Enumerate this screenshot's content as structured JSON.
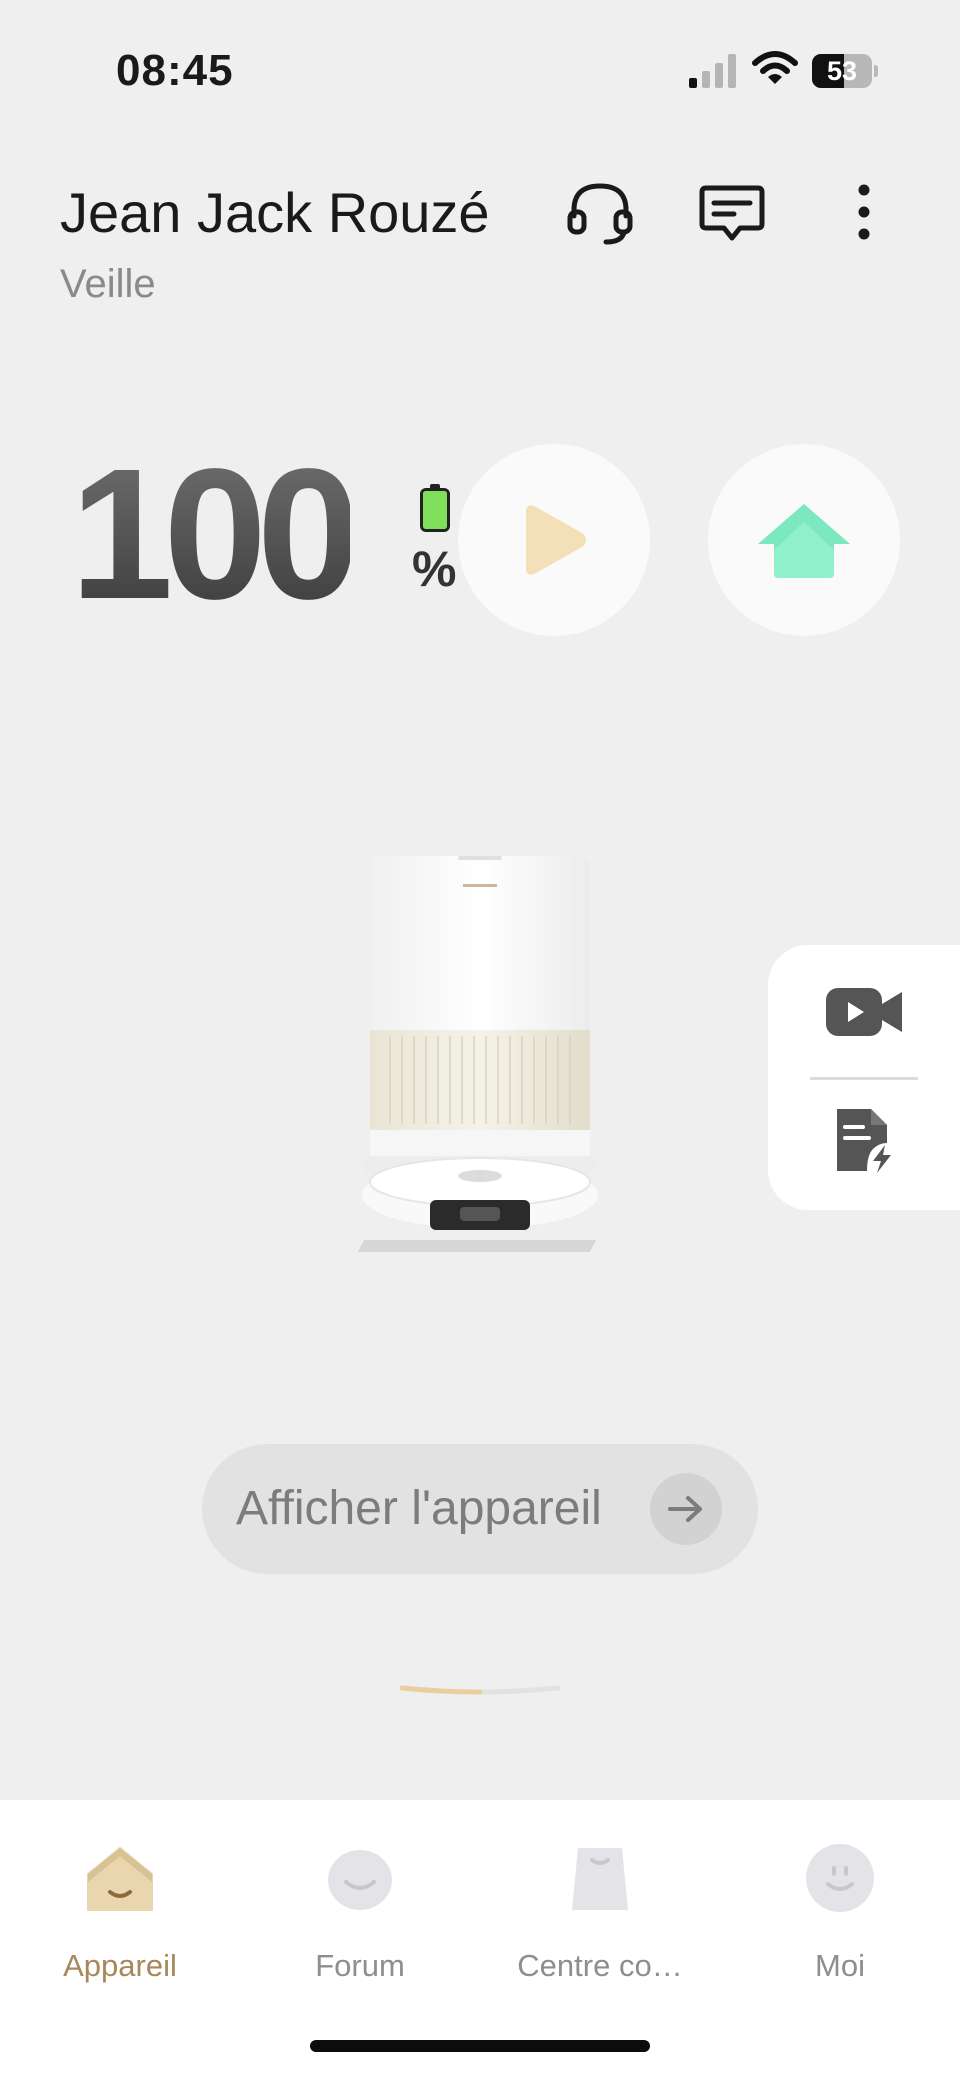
{
  "status_bar": {
    "time": "08:45",
    "battery_level": "53",
    "battery_fraction": 0.53,
    "signal_bars_active": 1
  },
  "header": {
    "device_name": "Jean Jack Rouzé",
    "status": "Veille",
    "icons": [
      "headset-support-icon",
      "message-icon",
      "more-vertical-icon"
    ]
  },
  "battery": {
    "value": "100",
    "unit": "%",
    "level": 1.0,
    "color": "#7ee05b"
  },
  "actions": {
    "start_icon": "play-icon",
    "start_color": "#f3dfb8",
    "dock_icon": "home-dock-icon",
    "dock_color": "#8ff0cc"
  },
  "side_panel": {
    "items": [
      "video-camera-icon",
      "quick-document-icon"
    ]
  },
  "show_device": {
    "label": "Afficher l'appareil",
    "icon": "arrow-right-icon"
  },
  "pager": {
    "active_fraction": 0.5,
    "active_color": "#eacf9e"
  },
  "tabbar": {
    "tabs": [
      {
        "label": "Appareil",
        "icon": "device-home-icon",
        "active": true
      },
      {
        "label": "Forum",
        "icon": "forum-icon",
        "active": false
      },
      {
        "label": "Centre co…",
        "icon": "shopping-bag-icon",
        "active": false
      },
      {
        "label": "Moi",
        "icon": "profile-face-icon",
        "active": false
      }
    ],
    "active_color": "#a8875a"
  },
  "colors": {
    "background": "#efefef",
    "accent": "#a8875a"
  }
}
